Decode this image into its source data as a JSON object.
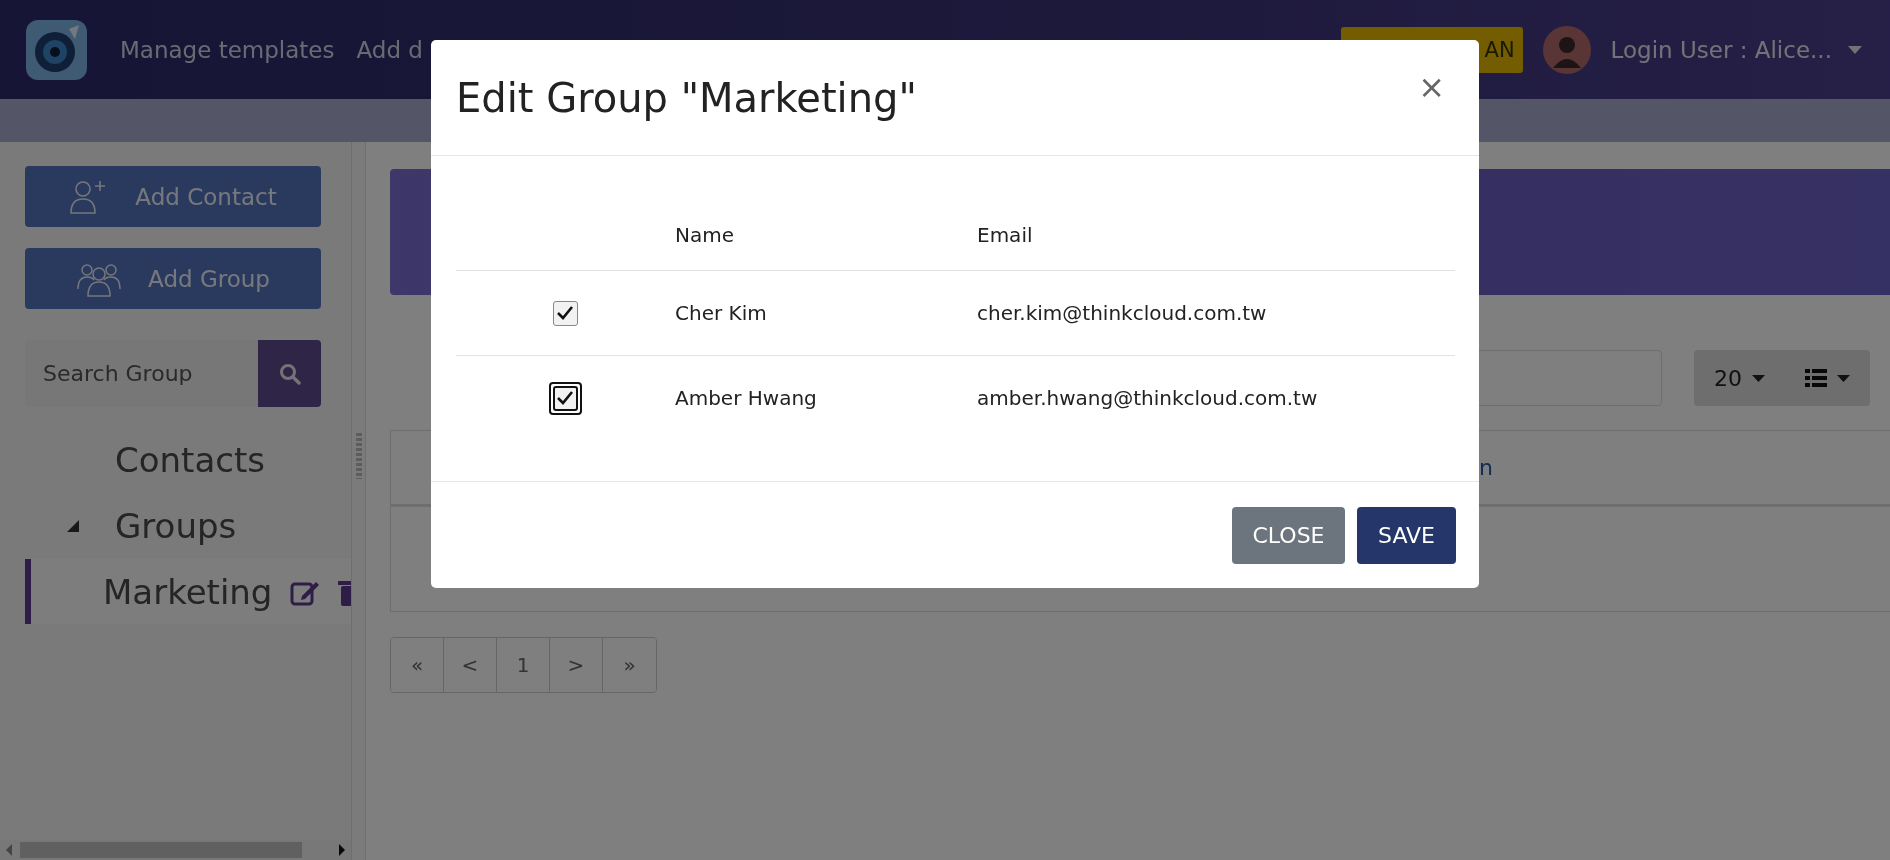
{
  "top_bar": {
    "nav_items": [
      {
        "label": "Manage templates"
      },
      {
        "label": "Add d"
      }
    ],
    "upgrade_button": "AN",
    "user_menu": {
      "label": "Login User : Alice..."
    }
  },
  "sidebar": {
    "buttons": [
      {
        "kind": "add-contact",
        "label": "Add Contact"
      },
      {
        "kind": "add-group",
        "label": "Add Group"
      }
    ],
    "search": {
      "placeholder": "Search Group"
    },
    "tree": [
      {
        "label": "Contacts",
        "selected": false
      },
      {
        "label": "Groups",
        "selected": false,
        "expanded": true,
        "children": [
          {
            "label": "Marketing",
            "selected": true
          }
        ]
      }
    ]
  },
  "content": {
    "page_size": "20",
    "table": {
      "columns": [
        {
          "label": "n"
        }
      ]
    },
    "pagination": [
      "«",
      "<",
      "1",
      ">",
      "»"
    ]
  },
  "dialog": {
    "title": "Edit Group \"Marketing\"",
    "close_label": "×",
    "columns": [
      "Name",
      "Email"
    ],
    "rows": [
      {
        "name": "Cher Kim",
        "email": "cher.kim@thinkcloud.com.tw",
        "checked": true,
        "focused": false
      },
      {
        "name": "Amber Hwang",
        "email": "amber.hwang@thinkcloud.com.tw",
        "checked": true,
        "focused": true
      }
    ],
    "buttons": [
      {
        "kind": "secondary",
        "label": "CLOSE"
      },
      {
        "kind": "primary",
        "label": "SAVE"
      }
    ]
  }
}
